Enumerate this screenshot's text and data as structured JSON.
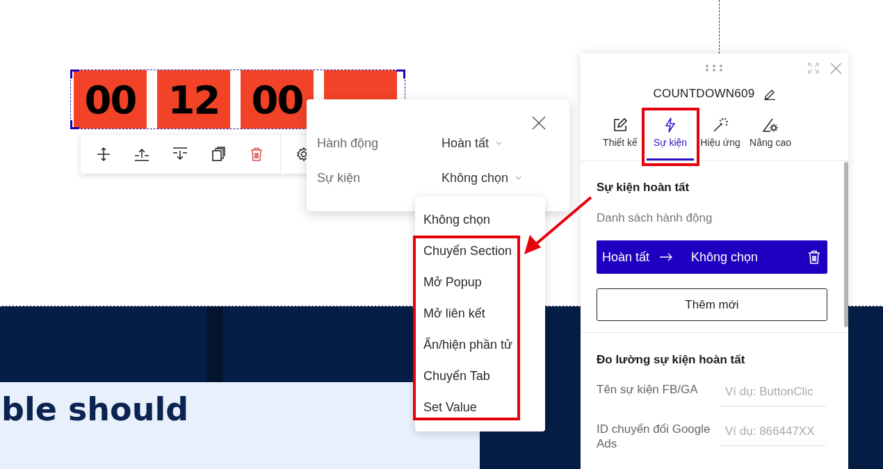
{
  "countdown": {
    "digits": [
      "00",
      "12",
      "00"
    ]
  },
  "page": {
    "heading": "ble should"
  },
  "action_popup": {
    "rows": [
      {
        "label": "Hành động",
        "value": "Hoàn tất"
      },
      {
        "label": "Sự kiện",
        "value": "Không chọn"
      }
    ]
  },
  "dropdown": {
    "options": [
      "Không chọn",
      "Chuyển Section",
      "Mở Popup",
      "Mở liên kết",
      "Ẩn/hiện phần tử",
      "Chuyển Tab",
      "Set Value"
    ]
  },
  "panel": {
    "title": "COUNTDOWN609",
    "tabs": [
      {
        "label": "Thiết kế",
        "selected": false
      },
      {
        "label": "Sự kiện",
        "selected": true
      },
      {
        "label": "Hiệu ứng",
        "selected": false
      },
      {
        "label": "Nâng cao",
        "selected": false
      }
    ],
    "section_title": "Sự kiện hoàn tất",
    "list_label": "Danh sách hành động",
    "actions": [
      {
        "trigger": "Hoàn tất",
        "action": "Không chọn"
      }
    ],
    "add_button": "Thêm mới",
    "tracking_title": "Đo lường sự kiện hoàn tất",
    "fields": [
      {
        "label": "Tên sự kiện FB/GA",
        "placeholder": "Ví dụ: ButtonClic"
      },
      {
        "label": "ID chuyển đổi Google Ads",
        "placeholder": "Ví dụ: 866447XX"
      }
    ]
  }
}
